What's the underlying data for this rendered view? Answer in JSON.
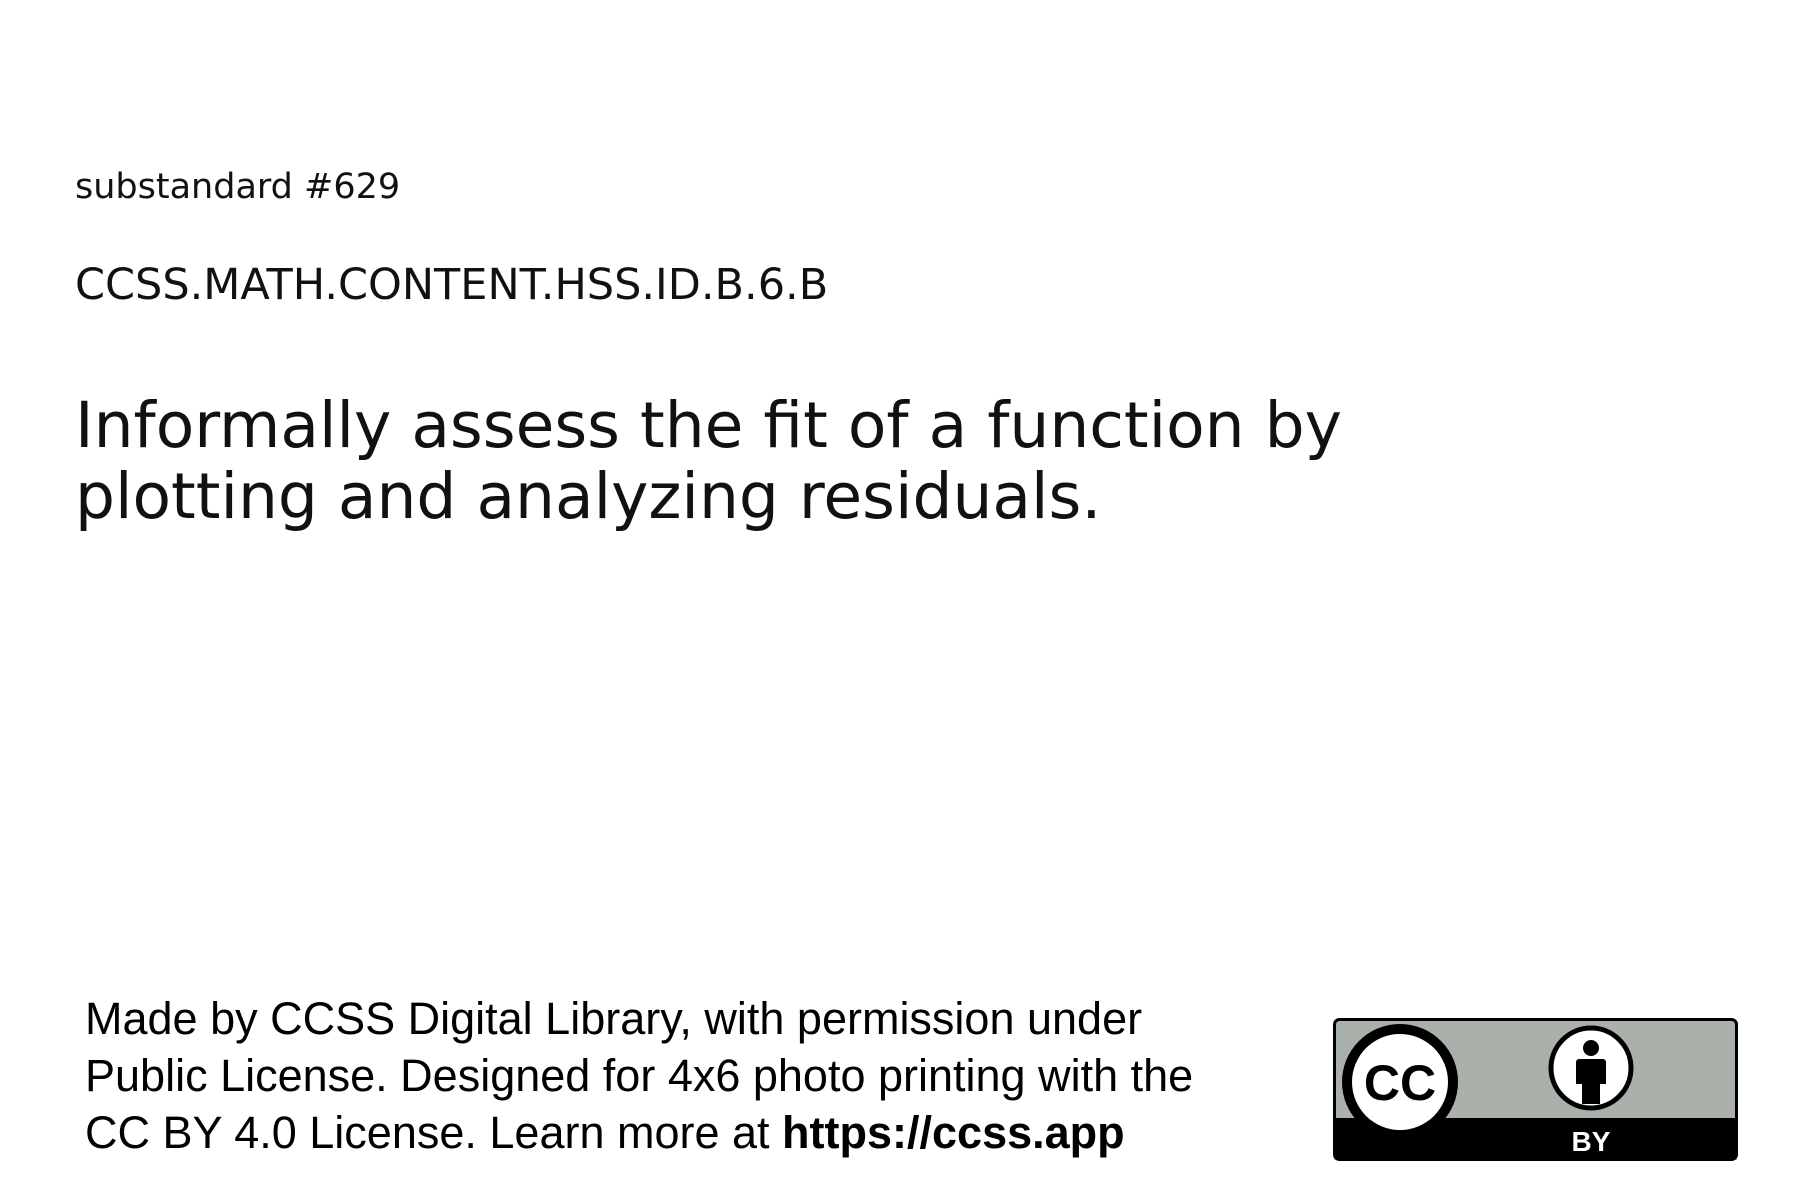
{
  "card": {
    "substandard": "substandard #629",
    "code": "CCSS.MATH.CONTENT.HSS.ID.B.6.B",
    "description": "Informally assess the fit of a function by plotting and analyzing residuals."
  },
  "footer": {
    "line1": "Made by CCSS Digital Library, with permission under",
    "line2": "Public License. Designed for 4x6 photo printing with the",
    "line3_prefix": "CC BY 4.0 License. Learn more at ",
    "url": "https://ccss.app"
  },
  "license_badge": {
    "cc_text": "CC",
    "by_text": "BY",
    "icons": [
      "cc-icon",
      "attribution-person-icon"
    ],
    "colors": {
      "badge_gray": "#aab1aa",
      "badge_black": "#000000",
      "icon_white": "#ffffff"
    }
  }
}
